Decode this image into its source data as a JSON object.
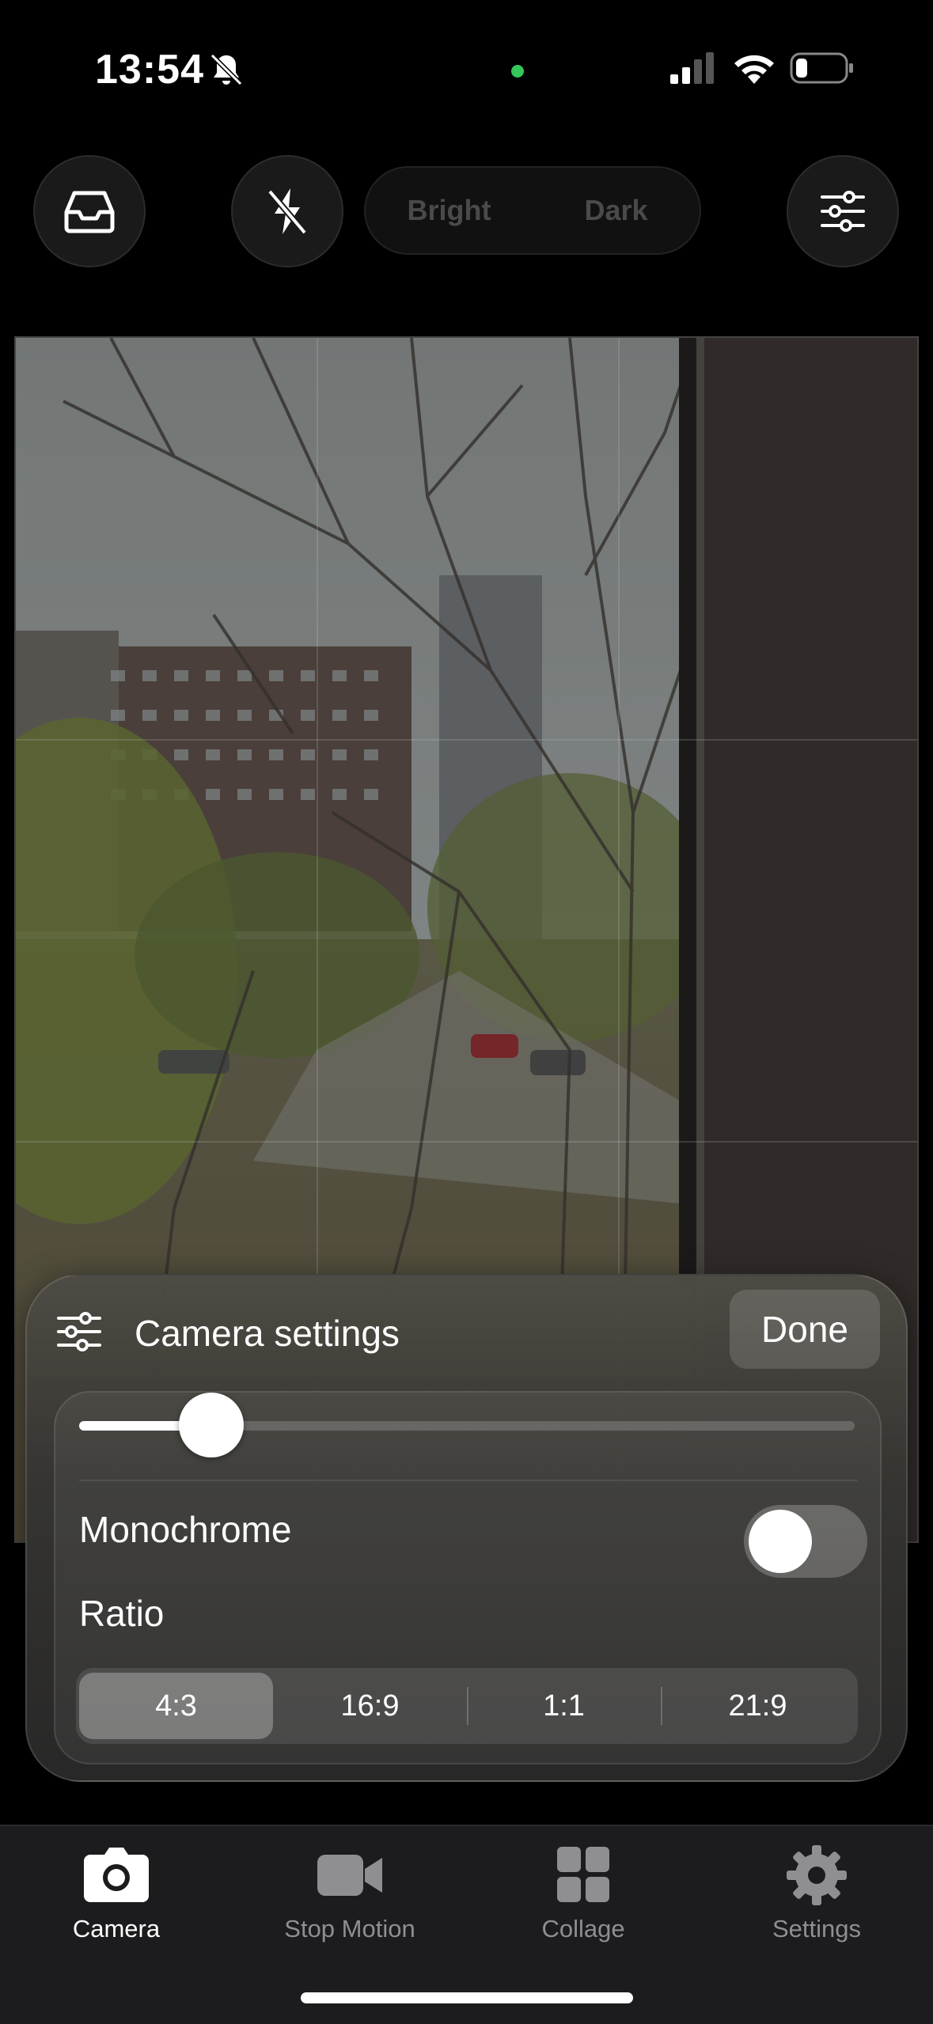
{
  "status_bar": {
    "time": "13:54",
    "icons": [
      "bell-slash-icon",
      "camera-in-use-dot",
      "cellular-signal-icon",
      "wifi-icon",
      "battery-icon"
    ],
    "accent_dot_color": "#34c759"
  },
  "top_controls": {
    "library_icon": "tray-icon",
    "flash_icon": "flash-off-icon",
    "tone_segment": {
      "options": [
        "Bright",
        "Dark"
      ]
    },
    "filters_icon": "sliders-icon"
  },
  "camera_settings": {
    "title": "Camera settings",
    "title_icon": "sliders-icon",
    "done_label": "Done",
    "slider_value": 0.17,
    "monochrome_label": "Monochrome",
    "monochrome_on": false,
    "ratio_label": "Ratio",
    "ratio_options": [
      "4:3",
      "16:9",
      "1:1",
      "21:9"
    ],
    "ratio_selected": "4:3"
  },
  "tab_bar": {
    "tabs": [
      {
        "label": "Camera",
        "icon": "camera-icon",
        "active": true
      },
      {
        "label": "Stop Motion",
        "icon": "video-icon",
        "active": false
      },
      {
        "label": "Collage",
        "icon": "grid-icon",
        "active": false
      },
      {
        "label": "Settings",
        "icon": "gear-icon",
        "active": false
      }
    ],
    "active_color": "#ffffff",
    "inactive_color": "#8e8e93"
  }
}
